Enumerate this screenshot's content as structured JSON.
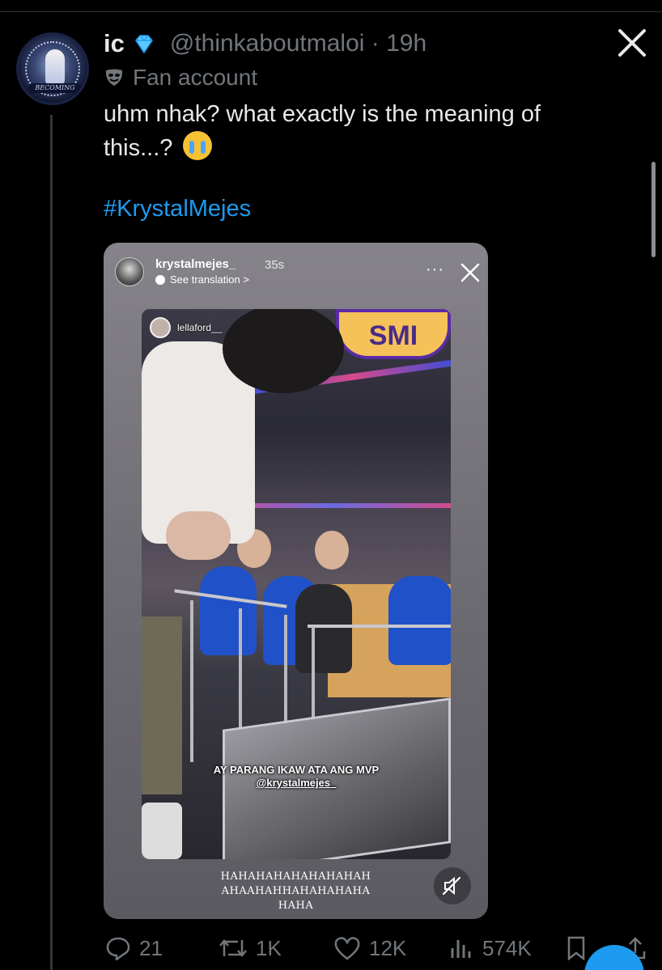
{
  "tweet": {
    "display_name": "ic",
    "handle_time": "@thinkaboutmaloi · 19h",
    "label": "Fan account",
    "text_line1": "uhm nhak? what exactly is the meaning of",
    "text_line2": "this...?",
    "hashtag": "#KrystalMejes",
    "avatar_ribbon": "BECOMING"
  },
  "story": {
    "username": "krystalmejes_",
    "time": "35s",
    "see_translation": "See translation >",
    "more": "···",
    "tagged_user": "lellaford__",
    "sign_text": "SMI",
    "caption_line1": "AY PARANG IKAW ATA ANG MVP",
    "caption_mention": "@krystalmejes_",
    "text_line1": "HAHAHAHAHAHAHAHAH",
    "text_line2": "AHAAHAHHAHAHAHAHA",
    "text_line3": "HAHA"
  },
  "actions": {
    "replies": "21",
    "reposts": "1K",
    "likes": "12K",
    "views": "574K"
  },
  "colors": {
    "accent": "#1d9bf0",
    "muted": "#71767b",
    "text": "#e7e9ea",
    "background": "#000000"
  }
}
